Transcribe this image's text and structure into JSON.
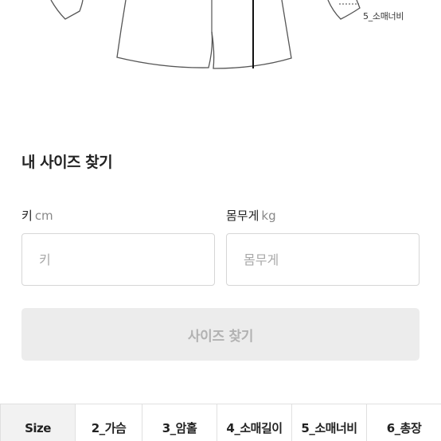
{
  "diagram": {
    "label": "5_소매너비"
  },
  "size_finder": {
    "title": "내 사이즈 찾기",
    "height_label": "키",
    "height_unit": "cm",
    "height_placeholder": "키",
    "height_value": "",
    "weight_label": "몸무게",
    "weight_unit": "kg",
    "weight_placeholder": "몸무게",
    "weight_value": "",
    "submit_label": "사이즈 찾기",
    "submit_enabled": false
  },
  "size_table": {
    "columns": [
      "Size",
      "2_가슴",
      "3_암홀",
      "4_소매길이",
      "5_소매너비",
      "6_총장"
    ]
  }
}
